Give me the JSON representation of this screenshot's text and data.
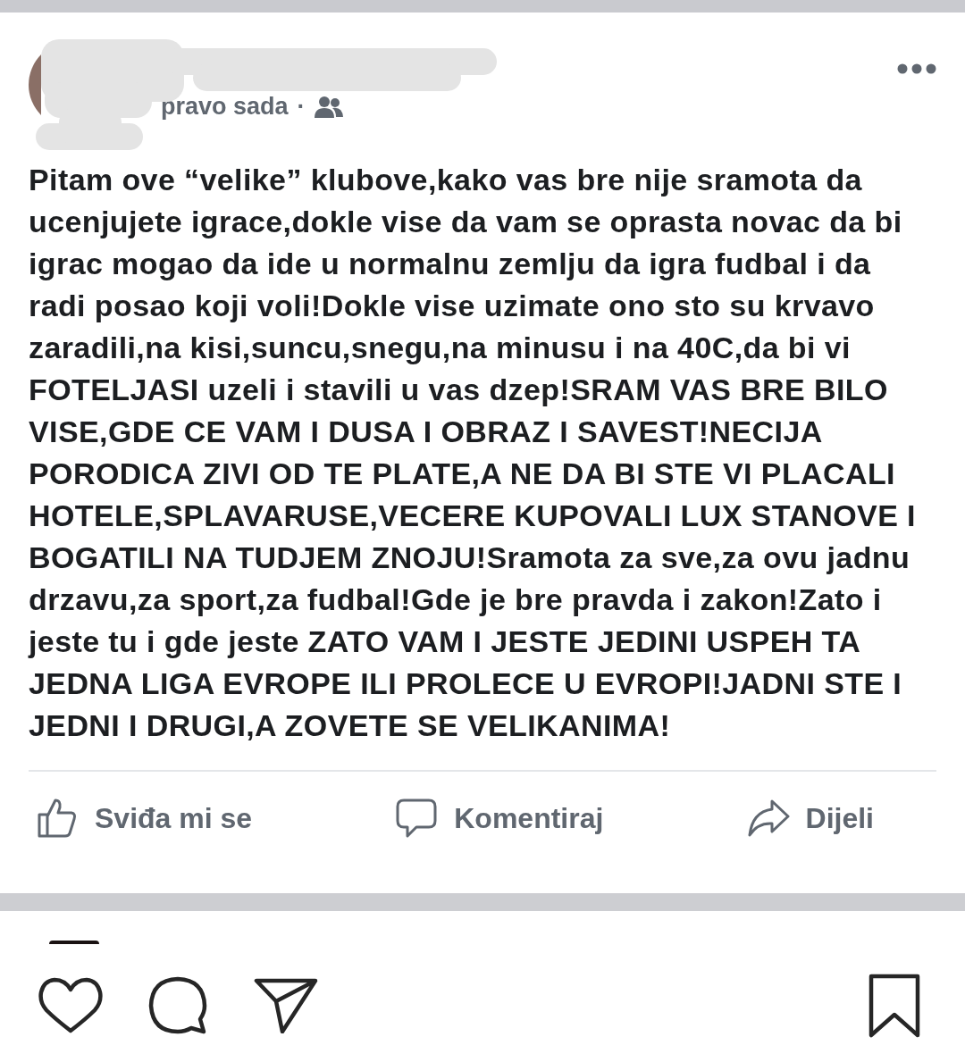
{
  "post": {
    "time": "pravo sada",
    "time_separator": "·",
    "text": "Pitam ove “velike” klubove,kako vas bre nije sramota da ucenjujete igrace,dokle vise da vam se oprasta novac da bi igrac mogao da ide u normalnu zemlju da igra fudbal i da radi posao koji voli!Dokle vise uzimate ono sto su krvavo zaradili,na kisi,suncu,snegu,na minusu i na 40C,da bi vi FOTELJASI uzeli i stavili u vas dzep!SRAM VAS BRE BILO VISE,GDE CE VAM I DUSA I OBRAZ I SAVEST!NECIJA PORODICA ZIVI OD TE PLATE,A NE DA BI STE VI PLACALI HOTELE,SPLAVARUSE,VECERE KUPOVALI LUX STANOVE I BOGATILI NA TUDJEM ZNOJU!Sramota za sve,za ovu jadnu drzavu,za sport,za fudbal!Gde je bre pravda i zakon!Zato i jeste tu i gde jeste ZATO VAM I JESTE JEDINI USPEH TA JEDNA LIGA EVROPE ILI PROLECE U EVROPI!JADNI STE I JEDNI I DRUGI,A ZOVETE SE VELIKANIMA!",
    "actions": [
      {
        "kind": "like",
        "label": "Sviđa mi se"
      },
      {
        "kind": "comment",
        "label": "Komentiraj"
      },
      {
        "kind": "share",
        "label": "Dijeli"
      }
    ]
  }
}
